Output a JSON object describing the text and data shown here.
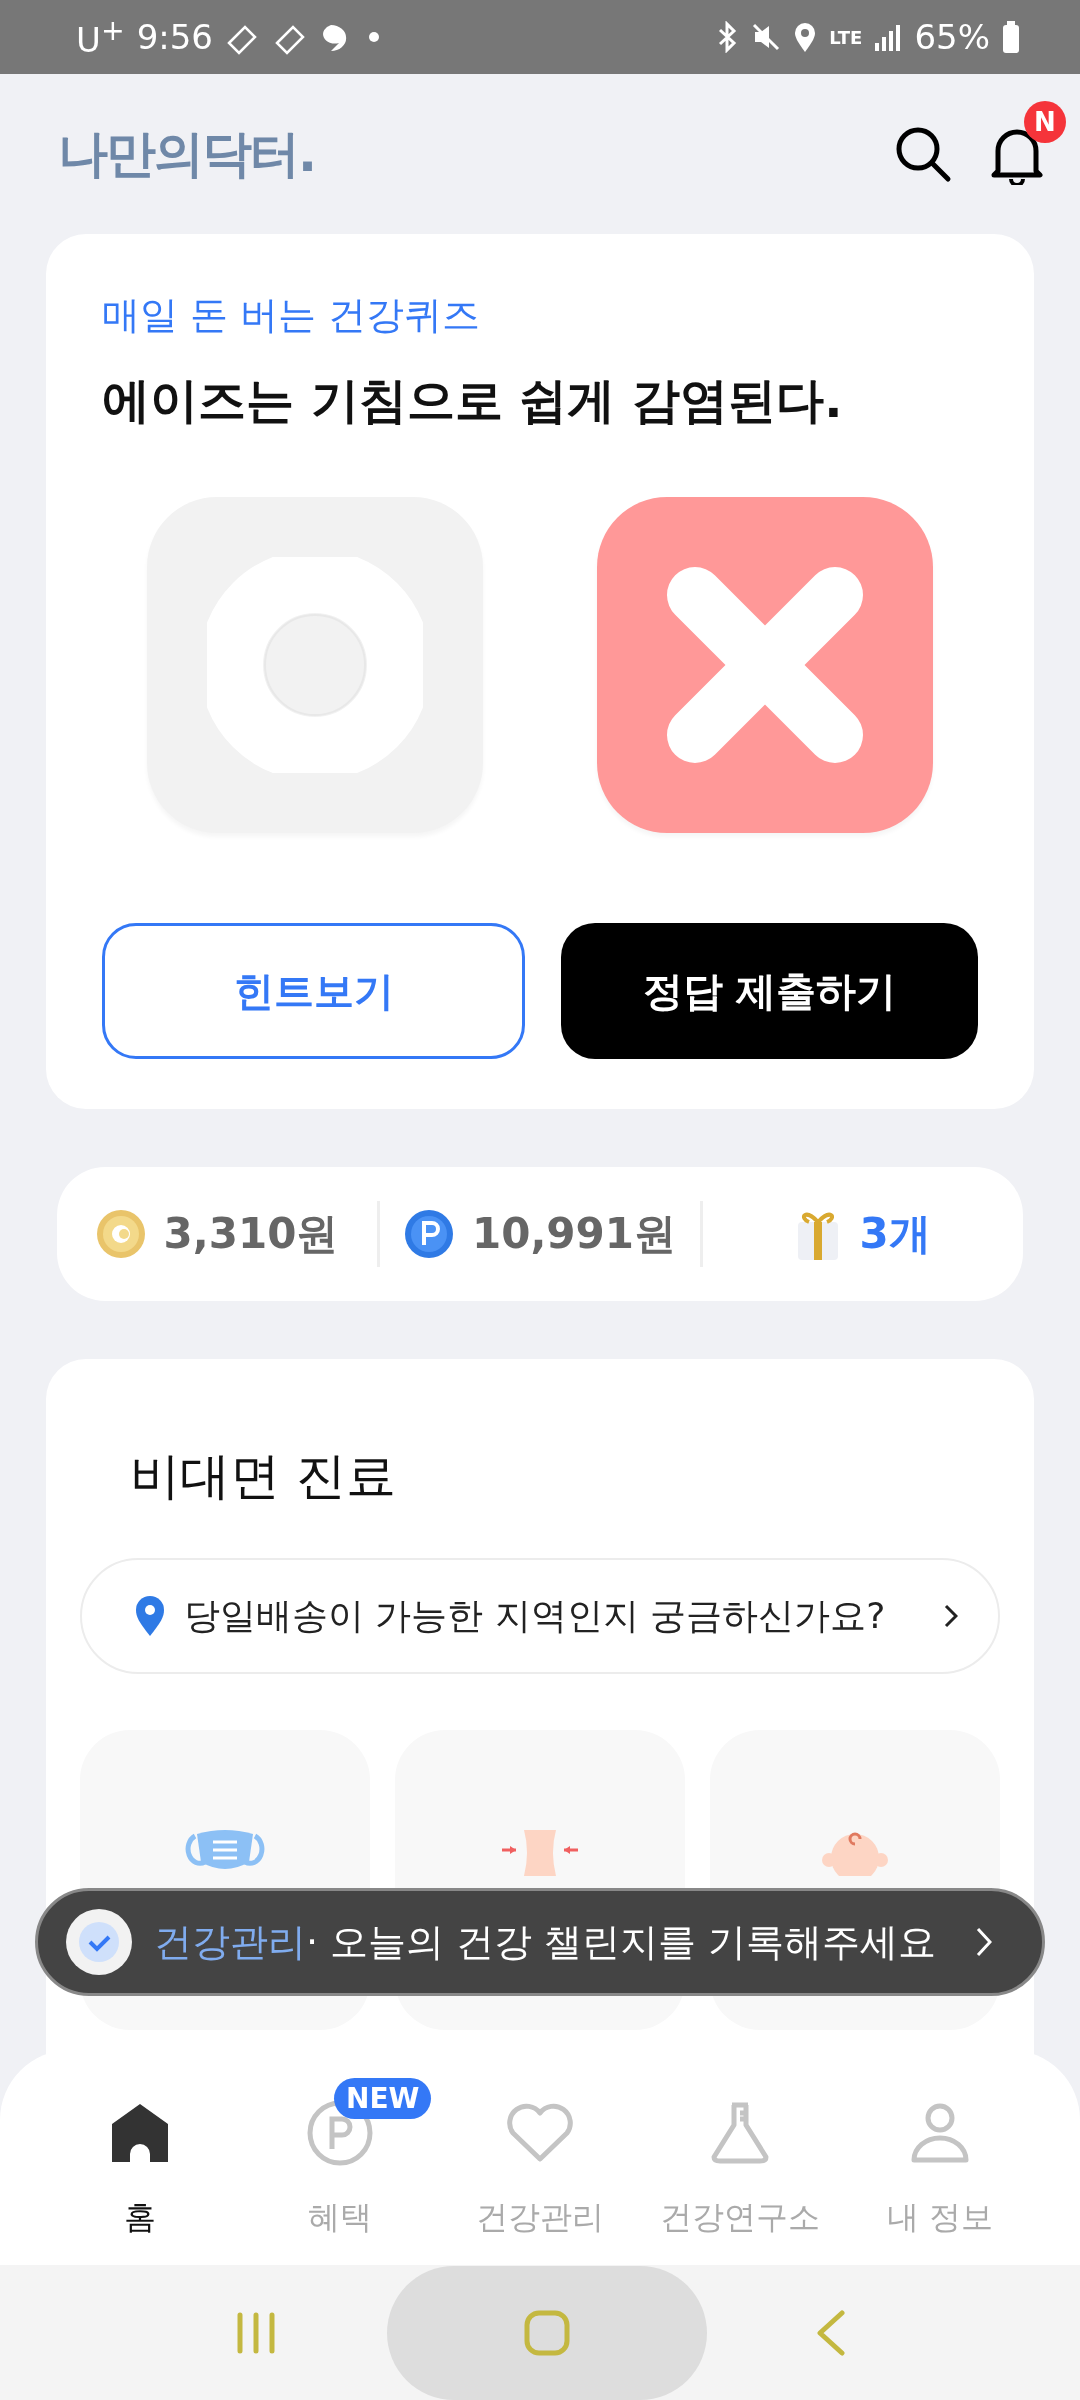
{
  "status_bar": {
    "carrier": "U$^{+}$",
    "time": "9:56",
    "network": "LTE",
    "battery": "65%"
  },
  "header": {
    "logo": "나만의닥터.",
    "notification_badge": "N"
  },
  "quiz": {
    "label": "매일 돈 버는 건강퀴즈",
    "question": "에이즈는 기침으로 쉽게 감염된다.",
    "answers": [
      {
        "kind": "o",
        "selected": false
      },
      {
        "kind": "x",
        "selected": true
      }
    ],
    "hint_button": "힌트보기",
    "submit_button": "정답 제출하기"
  },
  "points": [
    {
      "kind": "coin",
      "value": "3,310원"
    },
    {
      "kind": "point",
      "value": "10,991원"
    },
    {
      "kind": "gift",
      "value": "3개"
    }
  ],
  "telemedicine": {
    "title": "비대면 진료",
    "location_prompt": "당일배송이 가능한 지역인지 궁금하신가요?",
    "categories": [
      {
        "kind": "mask"
      },
      {
        "kind": "waist"
      },
      {
        "kind": "baby"
      }
    ]
  },
  "toast": {
    "tag": "건강관리",
    "message": "· 오늘의 건강 챌린지를 기록해주세요"
  },
  "bottom_nav": [
    {
      "kind": "home",
      "label": "홈",
      "selected": true
    },
    {
      "kind": "benefit",
      "label": "혜택",
      "selected": false,
      "badge": "NEW"
    },
    {
      "kind": "heart",
      "label": "건강관리",
      "selected": false
    },
    {
      "kind": "lab",
      "label": "건강연구소",
      "selected": false
    },
    {
      "kind": "person",
      "label": "내 정보",
      "selected": false
    }
  ]
}
